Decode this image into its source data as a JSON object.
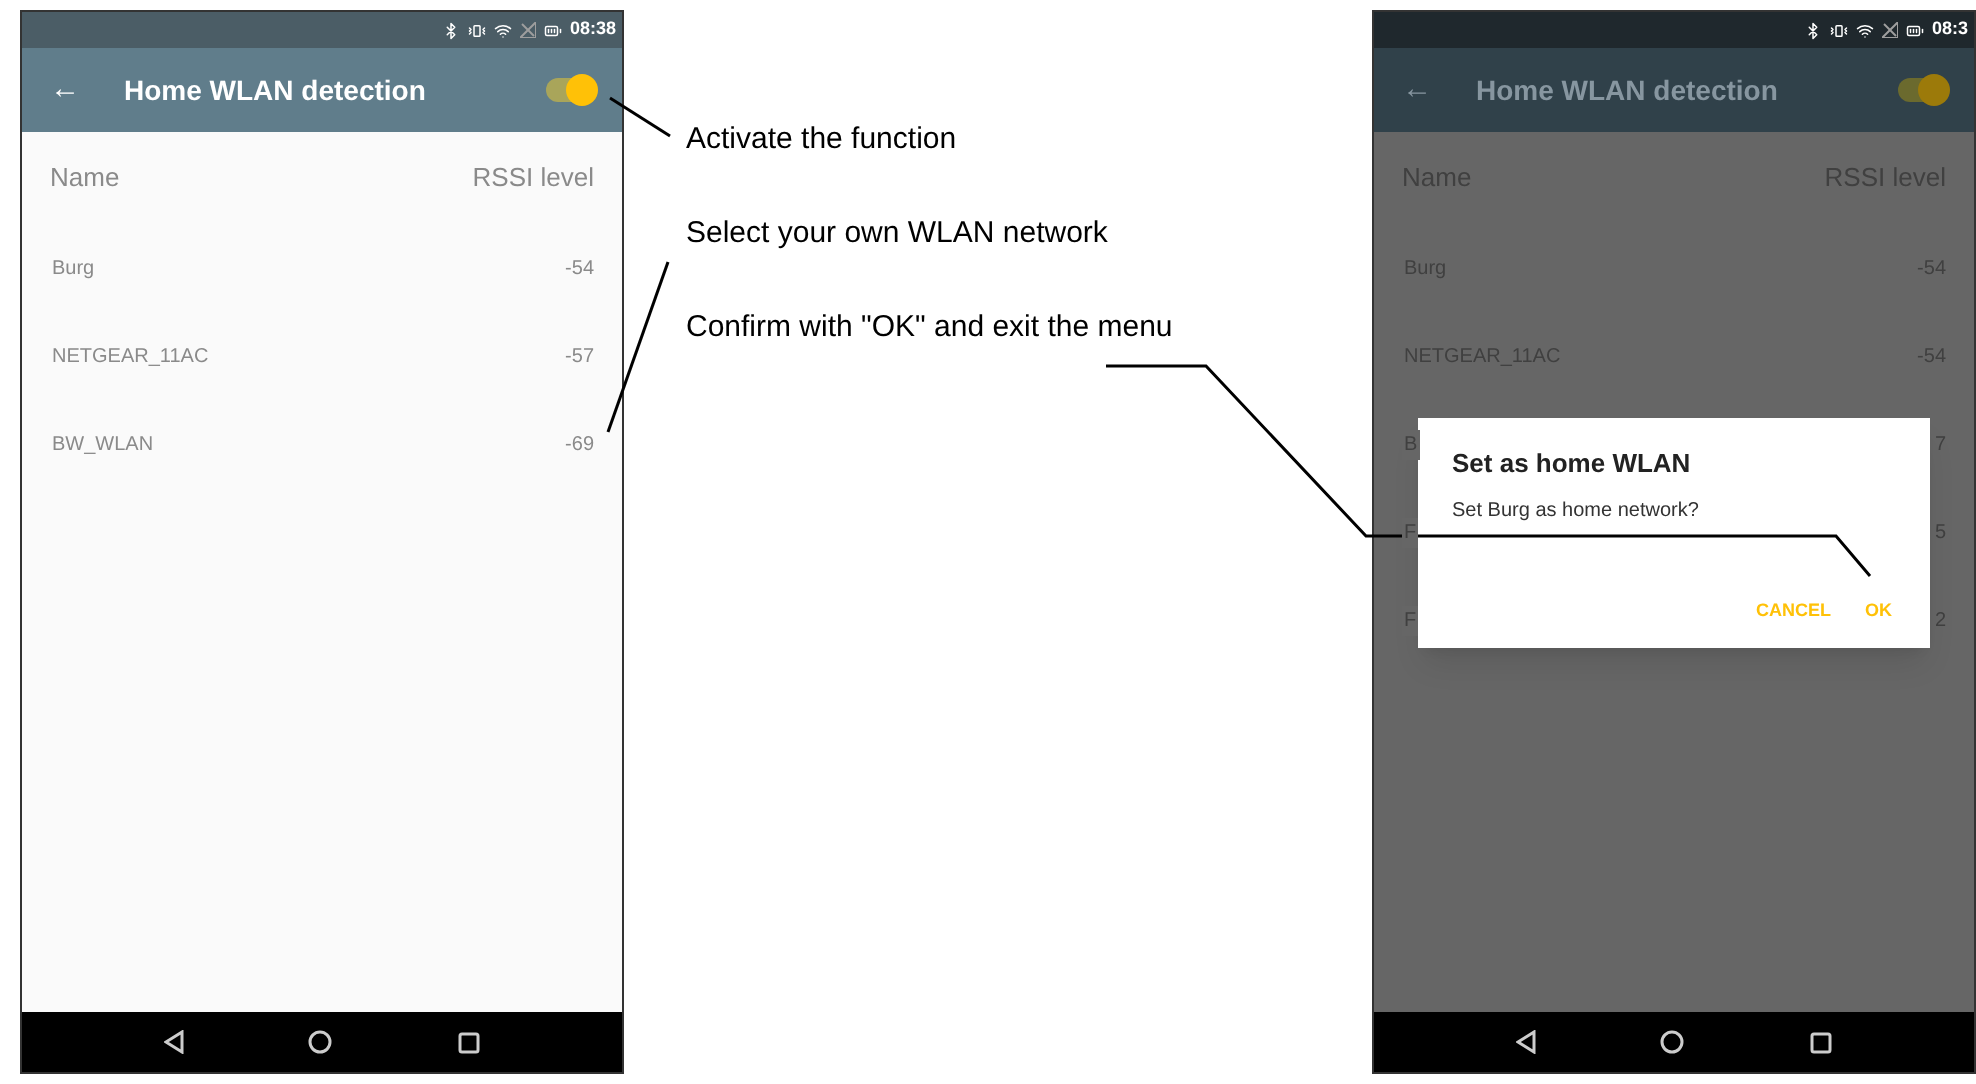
{
  "phones": [
    {
      "dimmed": false,
      "status_time": "08:38",
      "title": "Home WLAN detection",
      "back": "←",
      "toggle_on": true,
      "columns": [
        "Name",
        "RSSI level"
      ],
      "rows": [
        {
          "name": "Burg",
          "reading": "-54"
        },
        {
          "name": "NETGEAR_11AC",
          "reading": "-57"
        },
        {
          "name": "BW_WLAN",
          "reading": "-69"
        }
      ]
    },
    {
      "dimmed": true,
      "status_time": "08:3",
      "title": "Home WLAN detection",
      "back": "←",
      "toggle_on": true,
      "columns": [
        "Name",
        "RSSI level"
      ],
      "rows": [
        {
          "name": "Burg",
          "reading": "-54"
        },
        {
          "name": "NETGEAR_11AC",
          "reading": "-54"
        },
        {
          "name": "B",
          "reading": "7"
        },
        {
          "name": "F",
          "reading": "5"
        },
        {
          "name": "F",
          "reading": "2"
        }
      ],
      "dialog": {
        "title": "Set as home WLAN",
        "message": "Set Burg as home network?",
        "buttons": [
          "CANCEL",
          "OK"
        ]
      }
    }
  ],
  "annotations": [
    "Activate the function",
    "Select your own WLAN network",
    "Confirm with \"OK\" and exit the menu"
  ]
}
